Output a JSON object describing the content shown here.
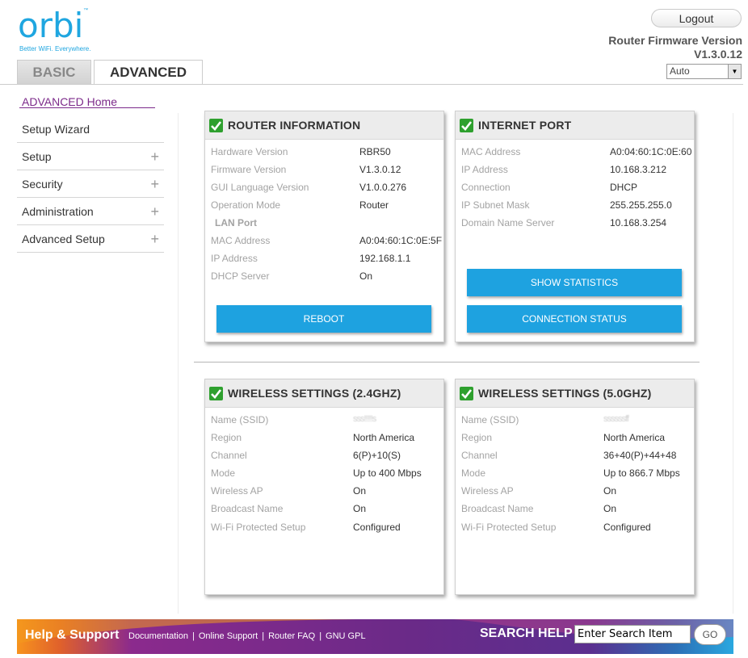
{
  "header": {
    "logo_text": "orbi",
    "logo_tm": "™",
    "logo_tagline": "Better WiFi. Everywhere.",
    "logout_label": "Logout",
    "firmware_title": "Router Firmware Version",
    "firmware_version": "V1.3.0.12",
    "language_selected": "Auto"
  },
  "tabs": [
    {
      "label": "BASIC",
      "active": false
    },
    {
      "label": "ADVANCED",
      "active": true
    }
  ],
  "sidebar": {
    "home": "ADVANCED Home",
    "items": [
      {
        "label": "Setup Wizard",
        "expandable": false
      },
      {
        "label": "Setup",
        "expandable": true
      },
      {
        "label": "Security",
        "expandable": true
      },
      {
        "label": "Administration",
        "expandable": true
      },
      {
        "label": "Advanced Setup",
        "expandable": true
      }
    ],
    "plus_glyph": "+"
  },
  "router_info": {
    "title": "ROUTER INFORMATION",
    "rows": [
      {
        "label": "Hardware Version",
        "value": "RBR50"
      },
      {
        "label": "Firmware Version",
        "value": "V1.3.0.12"
      },
      {
        "label": "GUI Language Version",
        "value": "V1.0.0.276"
      },
      {
        "label": "Operation Mode",
        "value": "Router"
      }
    ],
    "lan_heading": "LAN Port",
    "lan_rows": [
      {
        "label": "MAC Address",
        "value": "A0:04:60:1C:0E:5F"
      },
      {
        "label": "IP Address",
        "value": "192.168.1.1"
      },
      {
        "label": "DHCP Server",
        "value": "On"
      }
    ],
    "reboot_label": "REBOOT"
  },
  "internet_port": {
    "title": "INTERNET PORT",
    "rows": [
      {
        "label": "MAC Address",
        "value": "A0:04:60:1C:0E:60"
      },
      {
        "label": "IP Address",
        "value": "10.168.3.212"
      },
      {
        "label": "Connection",
        "value": "DHCP"
      },
      {
        "label": "IP Subnet Mask",
        "value": "255.255.255.0"
      },
      {
        "label": "Domain Name Server",
        "value": "10.168.3.254"
      }
    ],
    "show_stats_label": "SHOW STATISTICS",
    "conn_status_label": "CONNECTION STATUS"
  },
  "wireless_24": {
    "title": "WIRELESS SETTINGS (2.4GHZ)",
    "rows": [
      {
        "label": "Name (SSID)",
        "value": "sss!!!!!s"
      },
      {
        "label": "Region",
        "value": "North America"
      },
      {
        "label": "Channel",
        "value": "6(P)+10(S)"
      },
      {
        "label": "Mode",
        "value": "Up to 400 Mbps"
      },
      {
        "label": "Wireless AP",
        "value": "On"
      },
      {
        "label": "Broadcast Name",
        "value": "On"
      },
      {
        "label": "Wi-Fi Protected Setup",
        "value": "Configured"
      }
    ]
  },
  "wireless_50": {
    "title": "WIRELESS SETTINGS (5.0GHZ)",
    "rows": [
      {
        "label": "Name (SSID)",
        "value": "ssssssff"
      },
      {
        "label": "Region",
        "value": "North America"
      },
      {
        "label": "Channel",
        "value": "36+40(P)+44+48"
      },
      {
        "label": "Mode",
        "value": "Up to 866.7 Mbps"
      },
      {
        "label": "Wireless AP",
        "value": "On"
      },
      {
        "label": "Broadcast Name",
        "value": "On"
      },
      {
        "label": "Wi-Fi Protected Setup",
        "value": "Configured"
      }
    ]
  },
  "footer": {
    "help_title": "Help & Support",
    "links": [
      "Documentation",
      "Online Support",
      "Router FAQ",
      "GNU GPL"
    ],
    "link_sep": "|",
    "search_label": "SEARCH HELP",
    "search_value": "Enter Search Item",
    "go_label": "GO"
  },
  "colors": {
    "brand_blue": "#1fa6e0",
    "button_blue": "#1ea2e0",
    "nav_purple": "#7c2a8a",
    "check_green": "#2ea02e"
  }
}
